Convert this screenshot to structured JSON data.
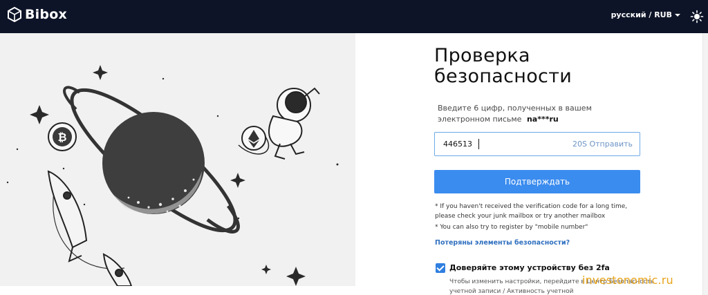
{
  "header": {
    "logo_text": "Bibox",
    "language_currency": "русский / RUB",
    "theme_icon": "sun-icon"
  },
  "form": {
    "title_line1": "Проверка",
    "title_line2": "безопасности",
    "hint_text": "Введите 6 цифр, полученных в вашем электронном письме",
    "email_masked": "na***ru",
    "code_value": "446513",
    "resend_label": "20S Отправить",
    "submit_label": "Подтверждать",
    "note1": "* If you haven't received the verification code for a long time, please check your junk mailbox or try another mailbox",
    "note2": "* You can also try to register by \"mobile number\"",
    "lost_link": "Потеряны элементы безопасности?",
    "trust_checked": true,
    "trust_label": "Доверяйте этому устройству без 2fa",
    "trust_sub": "Чтобы изменить настройки, перейдите в Центр Безопасность учетной записи / Активность учетной"
  },
  "watermark": "investonomic.ru",
  "colors": {
    "header_bg": "#0d1428",
    "primary": "#3b8cef",
    "link": "#2f6fbf",
    "watermark": "#e8a41a"
  }
}
